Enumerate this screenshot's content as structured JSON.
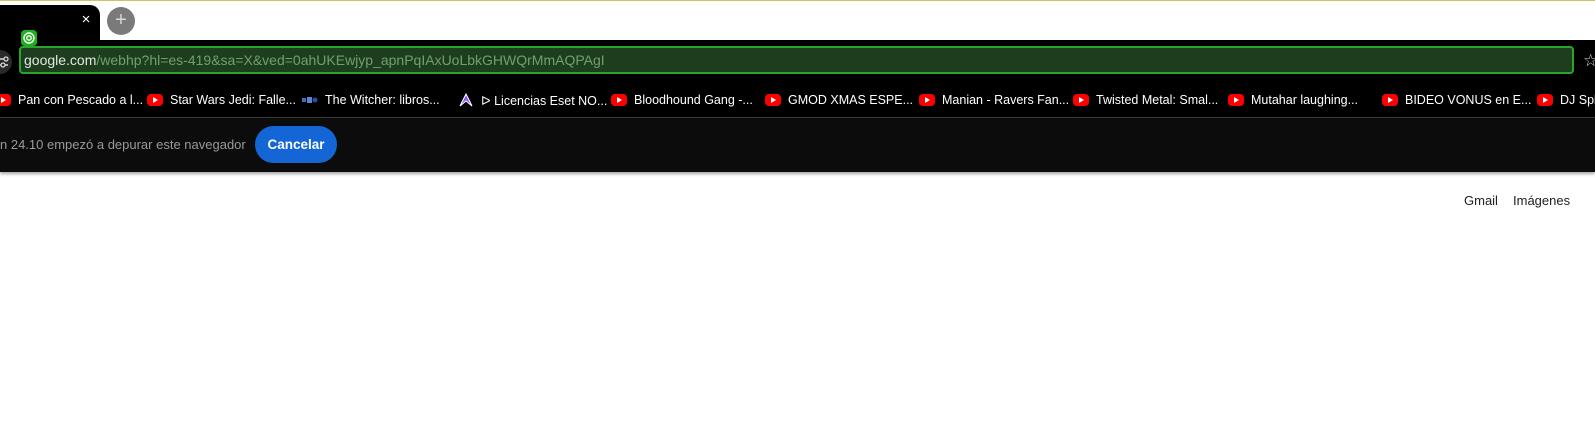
{
  "tab": {
    "close_glyph": "×",
    "favicon": "radar-icon"
  },
  "new_tab": {
    "glyph": "+"
  },
  "address_bar": {
    "host": "google.com",
    "path": "/webhp?hl=es-419&sa=X&ved=0ahUKEwjyp_apnPqIAxUoLbkGHWQrMmAQPAgI"
  },
  "bookmark_star": "☆",
  "bookmarks": [
    {
      "label": "Pan con Pescado a l...",
      "icon": "youtube-icon"
    },
    {
      "label": "Star Wars Jedi: Falle...",
      "icon": "youtube-icon"
    },
    {
      "label": "The Witcher: libros...",
      "icon": "site-icon"
    },
    {
      "label": "ᐅ Licencias Eset NO...",
      "icon": "purple-logo-icon"
    },
    {
      "label": "Bloodhound Gang -...",
      "icon": "youtube-icon"
    },
    {
      "label": "GMOD XMAS ESPE...",
      "icon": "youtube-icon"
    },
    {
      "label": "Manian - Ravers Fan...",
      "icon": "youtube-icon"
    },
    {
      "label": "Twisted Metal: Smal...",
      "icon": "youtube-icon"
    },
    {
      "label": "Mutahar laughing...",
      "icon": "youtube-icon"
    },
    {
      "label": "BIDEO VONUS en E...",
      "icon": "youtube-icon"
    },
    {
      "label": "DJ Spla",
      "icon": "youtube-icon"
    }
  ],
  "infobar": {
    "message": "n 24.10 empezó a depurar este navegador",
    "cancel_label": "Cancelar"
  },
  "google_links": {
    "gmail": "Gmail",
    "images": "Imágenes"
  },
  "colors": {
    "accent_green": "#2aa52a",
    "cancel_blue": "#1466d6",
    "youtube_red": "#ff0000"
  }
}
